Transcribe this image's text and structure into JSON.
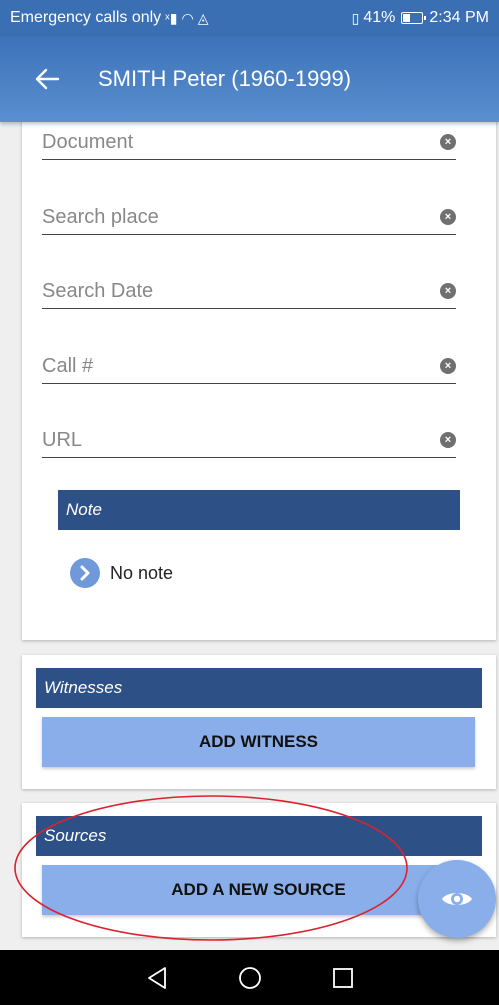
{
  "status_bar": {
    "carrier": "Emergency calls only",
    "battery_percent_text": "41%",
    "battery_level": 0.41,
    "time": "2:34 PM"
  },
  "app_bar": {
    "title": "SMITH Peter (1960-1999)",
    "back_icon": "arrow-left-icon"
  },
  "fields": [
    {
      "placeholder": "Document",
      "value": ""
    },
    {
      "placeholder": "Search place",
      "value": ""
    },
    {
      "placeholder": "Search Date",
      "value": ""
    },
    {
      "placeholder": "Call #",
      "value": ""
    },
    {
      "placeholder": "URL",
      "value": ""
    }
  ],
  "note": {
    "header": "Note",
    "empty_text": "No note"
  },
  "witnesses": {
    "header": "Witnesses",
    "button_label": "ADD WITNESS"
  },
  "sources": {
    "header": "Sources",
    "button_label": "ADD A NEW SOURCE"
  },
  "fab": {
    "icon": "eye-icon"
  },
  "colors": {
    "app_bar": "#3a6fb3",
    "section_header": "#2d5186",
    "button": "#8aaeea",
    "annotation": "#d9232e"
  }
}
